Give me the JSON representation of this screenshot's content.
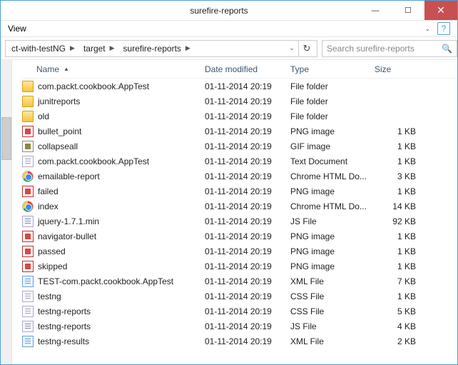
{
  "titlebar": {
    "title": "surefire-reports"
  },
  "menubar": {
    "view": "View"
  },
  "breadcrumb": {
    "items": [
      "ct-with-testNG",
      "target",
      "surefire-reports"
    ]
  },
  "search": {
    "placeholder": "Search surefire-reports"
  },
  "columns": {
    "name": "Name",
    "date": "Date modified",
    "type": "Type",
    "size": "Size"
  },
  "files": [
    {
      "icon": "folder",
      "name": "com.packt.cookbook.AppTest",
      "date": "01-11-2014 20:19",
      "type": "File folder",
      "size": ""
    },
    {
      "icon": "folder",
      "name": "junitreports",
      "date": "01-11-2014 20:19",
      "type": "File folder",
      "size": ""
    },
    {
      "icon": "folder",
      "name": "old",
      "date": "01-11-2014 20:19",
      "type": "File folder",
      "size": ""
    },
    {
      "icon": "png",
      "name": "bullet_point",
      "date": "01-11-2014 20:19",
      "type": "PNG image",
      "size": "1 KB"
    },
    {
      "icon": "gif",
      "name": "collapseall",
      "date": "01-11-2014 20:19",
      "type": "GIF image",
      "size": "1 KB"
    },
    {
      "icon": "txt",
      "name": "com.packt.cookbook.AppTest",
      "date": "01-11-2014 20:19",
      "type": "Text Document",
      "size": "1 KB"
    },
    {
      "icon": "chrome",
      "name": "emailable-report",
      "date": "01-11-2014 20:19",
      "type": "Chrome HTML Do...",
      "size": "3 KB"
    },
    {
      "icon": "png",
      "name": "failed",
      "date": "01-11-2014 20:19",
      "type": "PNG image",
      "size": "1 KB"
    },
    {
      "icon": "chrome",
      "name": "index",
      "date": "01-11-2014 20:19",
      "type": "Chrome HTML Do...",
      "size": "14 KB"
    },
    {
      "icon": "js",
      "name": "jquery-1.7.1.min",
      "date": "01-11-2014 20:19",
      "type": "JS File",
      "size": "92 KB"
    },
    {
      "icon": "png",
      "name": "navigator-bullet",
      "date": "01-11-2014 20:19",
      "type": "PNG image",
      "size": "1 KB"
    },
    {
      "icon": "png",
      "name": "passed",
      "date": "01-11-2014 20:19",
      "type": "PNG image",
      "size": "1 KB"
    },
    {
      "icon": "png",
      "name": "skipped",
      "date": "01-11-2014 20:19",
      "type": "PNG image",
      "size": "1 KB"
    },
    {
      "icon": "xml",
      "name": "TEST-com.packt.cookbook.AppTest",
      "date": "01-11-2014 20:19",
      "type": "XML File",
      "size": "7 KB"
    },
    {
      "icon": "css",
      "name": "testng",
      "date": "01-11-2014 20:19",
      "type": "CSS File",
      "size": "1 KB"
    },
    {
      "icon": "css",
      "name": "testng-reports",
      "date": "01-11-2014 20:19",
      "type": "CSS File",
      "size": "5 KB"
    },
    {
      "icon": "js",
      "name": "testng-reports",
      "date": "01-11-2014 20:19",
      "type": "JS File",
      "size": "4 KB"
    },
    {
      "icon": "xml",
      "name": "testng-results",
      "date": "01-11-2014 20:19",
      "type": "XML File",
      "size": "2 KB"
    }
  ]
}
